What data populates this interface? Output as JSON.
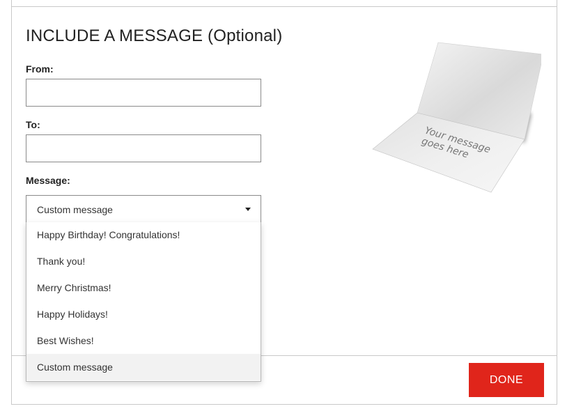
{
  "form": {
    "title": "INCLUDE A MESSAGE (Optional)",
    "from_label": "From:",
    "from_value": "",
    "to_label": "To:",
    "to_value": "",
    "message_label": "Message:",
    "message_selected": "Custom message"
  },
  "dropdown": {
    "options": [
      "Happy Birthday! Congratulations!",
      "Thank you!",
      "Merry Christmas!",
      "Happy Holidays!",
      "Best Wishes!",
      "Custom message"
    ]
  },
  "card": {
    "line1": "Your message",
    "line2": "goes here"
  },
  "footer": {
    "done_label": "DONE"
  },
  "colors": {
    "accent": "#e0251b",
    "border": "#c9c9c9",
    "highlight": "#f2f2f2"
  }
}
